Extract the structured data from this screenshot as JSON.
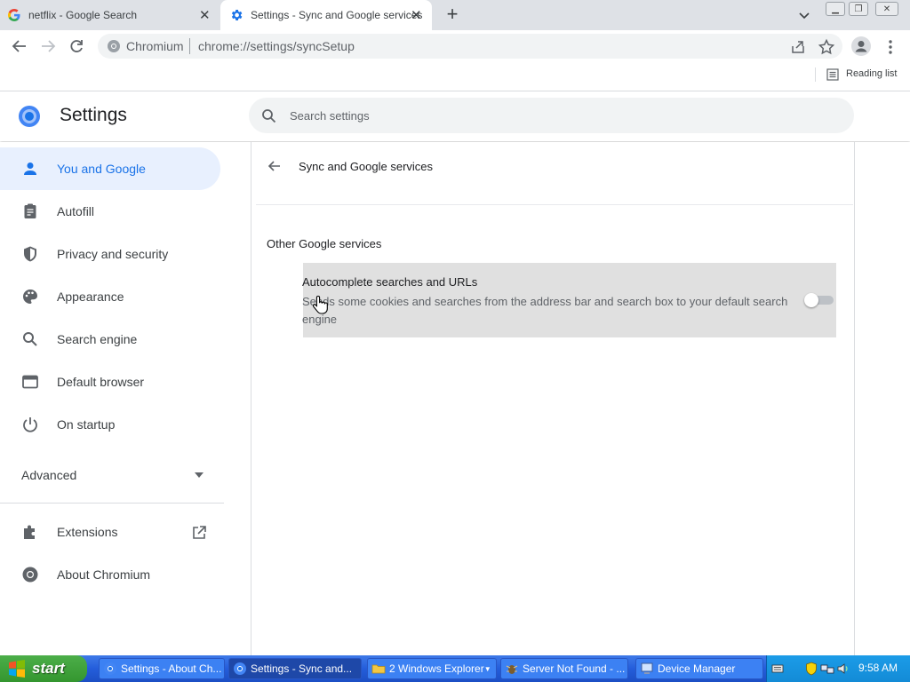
{
  "browser": {
    "tabs": [
      {
        "label": "netflix - Google Search",
        "icon": "google-g-icon",
        "active": false
      },
      {
        "label": "Settings - Sync and Google services",
        "icon": "settings-gear-icon",
        "active": true
      }
    ],
    "omnibox": {
      "site_chip": "Chromium",
      "url": "chrome://settings/syncSetup"
    },
    "bookmark_bar": {
      "reading_list": "Reading list"
    }
  },
  "settings": {
    "title": "Settings",
    "search_placeholder": "Search settings",
    "nav": [
      {
        "label": "You and Google",
        "icon": "person-icon",
        "active": true
      },
      {
        "label": "Autofill",
        "icon": "clipboard-icon"
      },
      {
        "label": "Privacy and security",
        "icon": "shield-icon"
      },
      {
        "label": "Appearance",
        "icon": "palette-icon"
      },
      {
        "label": "Search engine",
        "icon": "search-icon"
      },
      {
        "label": "Default browser",
        "icon": "browser-window-icon"
      },
      {
        "label": "On startup",
        "icon": "power-icon"
      }
    ],
    "advanced": "Advanced",
    "nav_bottom": [
      {
        "label": "Extensions",
        "icon": "puzzle-icon"
      },
      {
        "label": "About Chromium",
        "icon": "chromium-icon"
      }
    ],
    "page": {
      "heading": "Sync and Google services",
      "section": "Other Google services",
      "setting": {
        "title": "Autocomplete searches and URLs",
        "description": "Sends some cookies and searches from the address bar and search box to your default search engine",
        "enabled": false
      }
    }
  },
  "taskbar": {
    "start": "start",
    "tasks": [
      {
        "label": "Settings - About Ch...",
        "active": false
      },
      {
        "label": "Settings - Sync and...",
        "active": true
      },
      {
        "label": "2 Windows Explorer",
        "active": false
      },
      {
        "label": "Server Not Found - ...",
        "active": false
      },
      {
        "label": "Device Manager",
        "active": false
      }
    ],
    "clock": "9:58 AM"
  },
  "colors": {
    "accent": "#1a73e8",
    "active_nav_bg": "#e8f0fe",
    "taskbar_blue": "#245ddb",
    "start_green": "#34962f"
  }
}
